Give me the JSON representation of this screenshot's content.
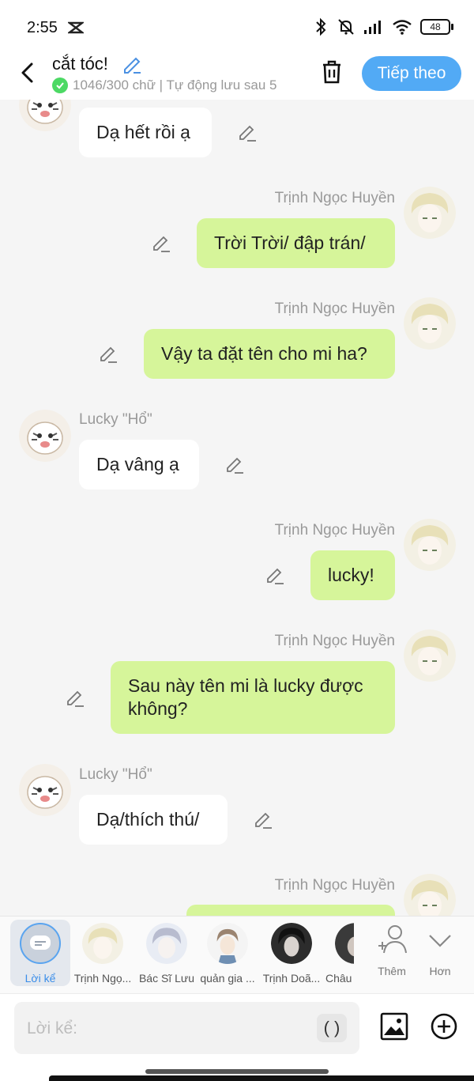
{
  "status": {
    "time": "2:55",
    "battery": "48"
  },
  "header": {
    "title": "cắt tóc!",
    "subtitle": "1046/300 chữ | Tự động lưu sau 5",
    "next_label": "Tiếp theo"
  },
  "messages": [
    {
      "side": "left",
      "text": "Dạ hết rồi ạ"
    },
    {
      "side": "right",
      "name": "Trịnh Ngọc Huyền",
      "text": "Trời Trời/ đập trán/"
    },
    {
      "side": "right",
      "name": "Trịnh Ngọc Huyền",
      "text": "Vậy ta đặt tên cho mi ha?"
    },
    {
      "side": "left",
      "name": "Lucky \"Hổ\"",
      "text": "Dạ vâng ạ"
    },
    {
      "side": "right",
      "name": "Trịnh Ngọc Huyền",
      "text": "lucky!"
    },
    {
      "side": "right",
      "name": "Trịnh Ngọc Huyền",
      "text": "Sau này tên mi là lucky được không?"
    },
    {
      "side": "left",
      "name": "Lucky \"Hổ\"",
      "text": "Dạ/thích thú/"
    },
    {
      "side": "right",
      "name": "Trịnh Ngọc Huyền",
      "text": ""
    }
  ],
  "characters": [
    {
      "label": "Lời kể",
      "icon": "narration-icon",
      "active": true
    },
    {
      "label": "Trịnh Ngọ...",
      "icon": "avatar"
    },
    {
      "label": "Bác Sĩ Lưu",
      "icon": "avatar"
    },
    {
      "label": "quản gia ...",
      "icon": "avatar"
    },
    {
      "label": "Trịnh Doã...",
      "icon": "avatar"
    },
    {
      "label": "Châu",
      "icon": "avatar"
    }
  ],
  "tools": {
    "add_label": "Thêm",
    "more_label": "Hơn"
  },
  "input": {
    "placeholder": "Lời kể:",
    "paren": "( )"
  },
  "colors": {
    "accent": "#52aaf5",
    "right_bubble": "#d6f59a",
    "left_bubble": "#ffffff"
  }
}
